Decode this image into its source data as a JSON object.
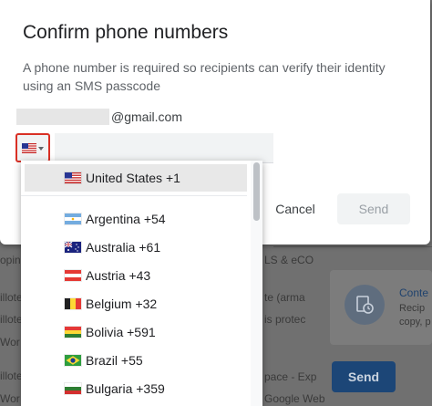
{
  "dialog": {
    "title": "Confirm phone numbers",
    "description": "A phone number is required so recipients can verify their identity using an SMS passcode",
    "email_domain": "@gmail.com",
    "cancel_label": "Cancel",
    "send_label": "Send"
  },
  "country_picker": {
    "selected_flag": "us-flag-icon",
    "items": [
      {
        "label": "United States +1",
        "flag": "us-flag-icon",
        "selected": true
      },
      {
        "label": "Argentina +54",
        "flag": "argentina-flag-icon"
      },
      {
        "label": "Australia +61",
        "flag": "australia-flag-icon"
      },
      {
        "label": "Austria +43",
        "flag": "austria-flag-icon"
      },
      {
        "label": "Belgium +32",
        "flag": "belgium-flag-icon"
      },
      {
        "label": "Bolivia +591",
        "flag": "bolivia-flag-icon"
      },
      {
        "label": "Brazil +55",
        "flag": "brazil-flag-icon"
      },
      {
        "label": "Bulgaria +359",
        "flag": "bulgaria-flag-icon"
      }
    ]
  },
  "background": {
    "left_snippets": [
      "opin",
      "illote",
      "illote",
      "Wor",
      "illote",
      "Wor"
    ],
    "right_snippets": [
      "LS & eCO",
      "te (arma",
      "is protec",
      "pace - Exp",
      "Google Web"
    ],
    "card_title": "Conte",
    "card_lines": [
      "Recip",
      "copy, p"
    ],
    "send_label": "Send"
  },
  "colors": {
    "highlight_border": "#d93025",
    "send_disabled_bg": "#f1f3f4",
    "bg_send": "#1c4677"
  }
}
